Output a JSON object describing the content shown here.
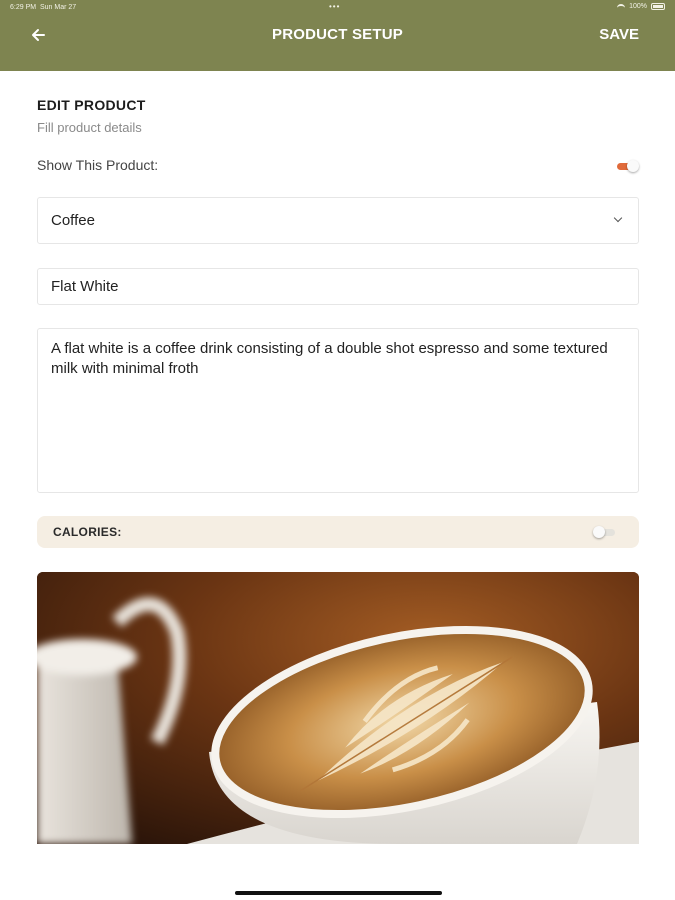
{
  "status_bar": {
    "time": "6:29 PM",
    "date": "Sun Mar 27",
    "battery": "100%"
  },
  "header": {
    "back_icon": "arrow-left-icon",
    "title": "PRODUCT SETUP",
    "save_label": "SAVE",
    "background": "#7e8450"
  },
  "form": {
    "heading": "EDIT PRODUCT",
    "subheading": "Fill product details",
    "show_product_label": "Show This Product:",
    "show_product_enabled": true,
    "category_value": "Coffee",
    "name_value": "Flat White",
    "description_value": "A flat white is a coffee drink consisting of a double shot espresso and some textured milk with minimal froth",
    "calories_label": "CALORIES:",
    "calories_enabled": false,
    "accent_color": "#e06a3a"
  },
  "image": {
    "icon": "coffee-latte-art-photo"
  }
}
